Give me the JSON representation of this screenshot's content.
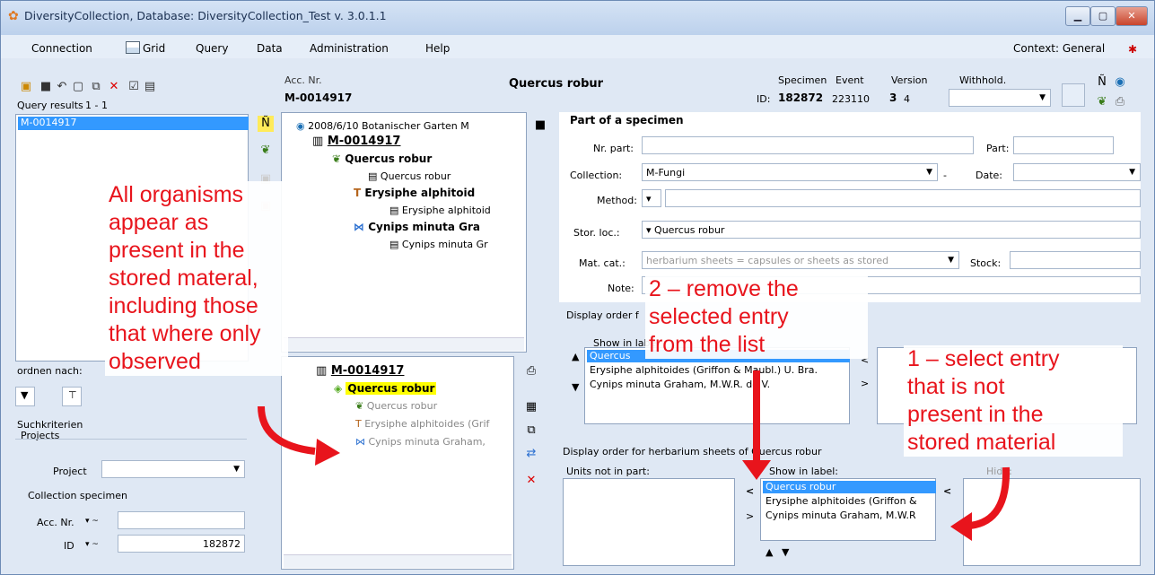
{
  "window": {
    "title": "DiversityCollection,  Database: DiversityCollection_Test   v. 3.0.1.1",
    "min": "▁",
    "max": "▢",
    "close": "✕"
  },
  "menu": {
    "items": [
      "Connection",
      "Grid",
      "Query",
      "Data",
      "Administration",
      "Help"
    ],
    "context": "Context: General"
  },
  "header": {
    "acc_label": "Acc. Nr.",
    "acc_value": "M-0014917",
    "taxon": "Quercus robur",
    "id_label": "ID:",
    "specimen_label": "Specimen",
    "specimen_value": "182872",
    "event_label": "Event",
    "event_value": "223110",
    "version_label": "Version",
    "version_value": "3",
    "version_value2": "4",
    "withhold_label": "Withhold."
  },
  "query": {
    "results_label": "Query results",
    "results_count": "1 - 1",
    "items": [
      "M-0014917"
    ],
    "order_label": "ordnen nach:",
    "search_label": "Suchkriterien",
    "projects_group": "Projects",
    "project_label": "Project",
    "collection_group": "Collection specimen",
    "acc_label": "Acc. Nr.",
    "id_label": "ID",
    "id_value": "182872"
  },
  "tree_top": {
    "event": "2008/6/10 Botanischer Garten M",
    "specimen": "M-0014917",
    "unit1": "Quercus robur",
    "unit1_ident": "Quercus robur",
    "unit2": "Erysiphe alphitoid",
    "unit2_ident": "Erysiphe alphitoid",
    "unit3": "Cynips minuta Gra",
    "unit3_ident": "Cynips minuta Gr"
  },
  "tree_bottom": {
    "specimen": "M-0014917",
    "part": "Quercus robur",
    "unit1": "Quercus robur",
    "unit2": "Erysiphe alphitoides (Grif",
    "unit3": "Cynips minuta Graham,"
  },
  "part": {
    "title": "Part of a specimen",
    "nr_label": "Nr. part:",
    "part_label": "Part:",
    "collection_label": "Collection:",
    "collection_value": "M-Fungi",
    "date_label": "Date:",
    "method_label": "Method:",
    "storloc_label": "Stor. loc.:",
    "storloc_value": "Quercus robur",
    "matcat_label": "Mat. cat.:",
    "matcat_value": "herbarium sheets    = capsules or sheets as stored",
    "stock_label": "Stock:",
    "note_label": "Note:"
  },
  "display_order": {
    "title": "Display order f",
    "show_label": "Show in label",
    "items": [
      "Quercus",
      "Erysiphe alphitoides (Griffon & Maubl.) U. Bra.",
      "Cynips minuta Graham, M.W.R. de V."
    ],
    "move_left": "<",
    "move_right": ">"
  },
  "display_order_herb": {
    "title": "Display order for herbarium sheets of Quercus robur",
    "not_in_part_label": "Units not in part:",
    "show_label": "Show in label:",
    "hide_label": "Hide:",
    "items": [
      "Quercus robur",
      "Erysiphe alphitoides (Griffon &",
      "Cynips minuta Graham, M.W.R"
    ],
    "move_left": "<",
    "move_right": ">",
    "hide_left": "<",
    "up": "▲",
    "down": "▼"
  },
  "annotations": {
    "left": [
      "All organisms",
      "appear as",
      "present in the",
      "stored materal,",
      "including those",
      "that where only",
      "observed"
    ],
    "step2": [
      "2 – remove the",
      "selected entry",
      "from the list"
    ],
    "step1": [
      "1 – select entry",
      "that is not",
      "present in the",
      "stored material"
    ]
  },
  "colors": {
    "annotation": "#e8141c",
    "selection": "#3399ff",
    "highlight": "#ffff00"
  }
}
